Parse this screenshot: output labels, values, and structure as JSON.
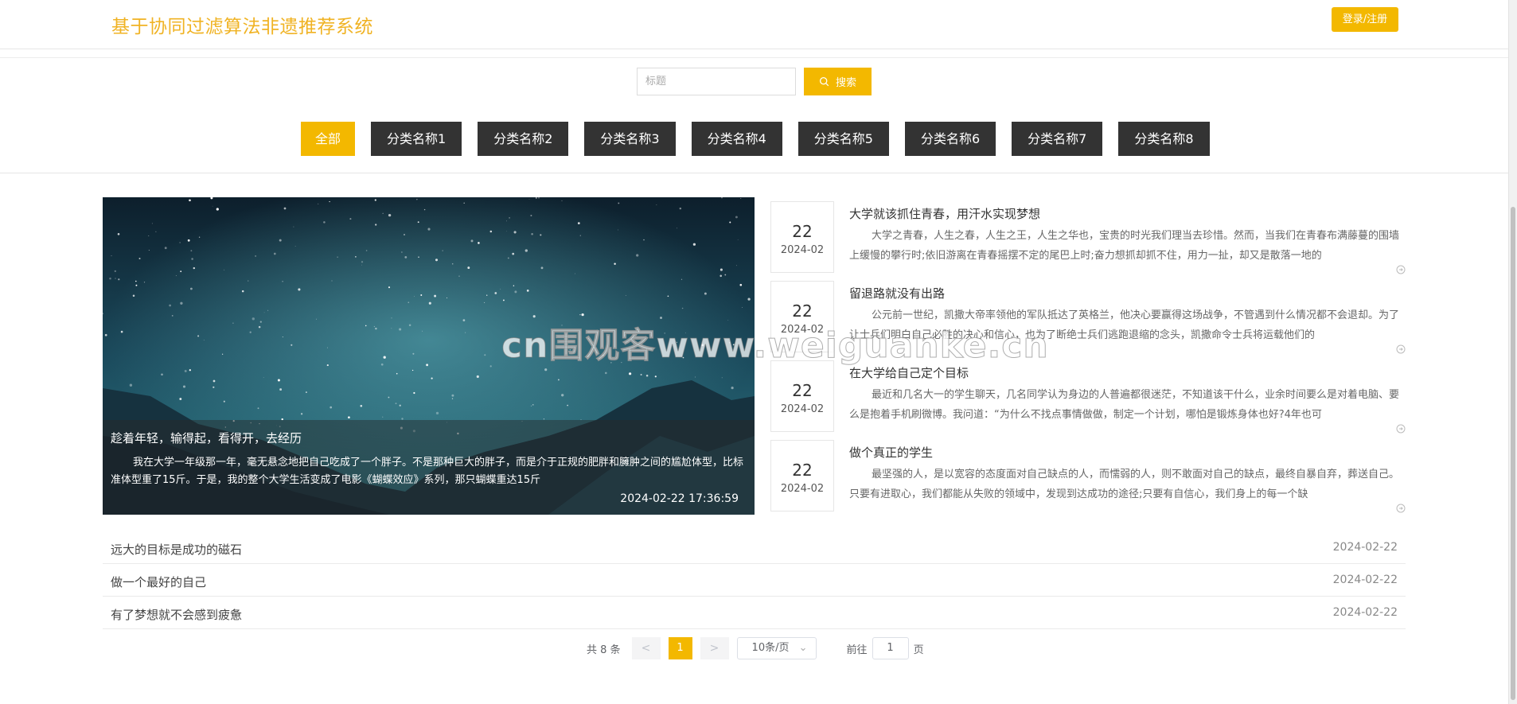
{
  "header": {
    "title": "基于协同过滤算法非遗推荐系统",
    "login_label": "登录/注册"
  },
  "search": {
    "placeholder": "标题",
    "button_label": "搜索"
  },
  "categories": [
    "全部",
    "分类名称1",
    "分类名称2",
    "分类名称3",
    "分类名称4",
    "分类名称5",
    "分类名称6",
    "分类名称7",
    "分类名称8"
  ],
  "featured": {
    "title": "趁着年轻，输得起，看得开，去经历",
    "desc": "我在大学一年级那一年，毫无悬念地把自己吃成了一个胖子。不是那种巨大的胖子，而是介于正规的肥胖和臃肿之间的尴尬体型，比标准体型重了15斤。于是，我的整个大学生活变成了电影《蝴蝶效应》系列，那只蝴蝶重达15斤",
    "datetime": "2024-02-22 17:36:59"
  },
  "news": [
    {
      "day": "22",
      "ym": "2024-02",
      "title": "大学就该抓住青春，用汗水实现梦想",
      "desc": "大学之青春，人生之春，人生之王，人生之华也，宝贵的时光我们理当去珍惜。然而，当我们在青春布满藤蔓的围墙上缓慢的攀行时;依旧游离在青春摇摆不定的尾巴上时;奋力想抓却抓不住，用力一扯，却又是散落一地的"
    },
    {
      "day": "22",
      "ym": "2024-02",
      "title": "留退路就没有出路",
      "desc": "公元前一世纪，凯撒大帝率领他的军队抵达了英格兰，他决心要赢得这场战争，不管遇到什么情况都不会退却。为了让士兵们明白自己必胜的决心和信心，也为了断绝士兵们逃跑退缩的念头，凯撒命令士兵将运载他们的"
    },
    {
      "day": "22",
      "ym": "2024-02",
      "title": "在大学给自己定个目标",
      "desc": "最近和几名大一的学生聊天，几名同学认为身边的人普遍都很迷茫，不知道该干什么，业余时间要么是对着电脑、要么是抱着手机刷微博。我问道：“为什么不找点事情做做，制定一个计划，哪怕是锻炼身体也好?4年也可"
    },
    {
      "day": "22",
      "ym": "2024-02",
      "title": "做个真正的学生",
      "desc": "最坚强的人，是以宽容的态度面对自己缺点的人，而懦弱的人，则不敢面对自己的缺点，最终自暴自弃，葬送自己。只要有进取心，我们都能从失败的领域中，发现到达成功的途径;只要有自信心，我们身上的每一个缺"
    }
  ],
  "list": [
    {
      "title": "远大的目标是成功的磁石",
      "date": "2024-02-22"
    },
    {
      "title": "做一个最好的自己",
      "date": "2024-02-22"
    },
    {
      "title": "有了梦想就不会感到疲惫",
      "date": "2024-02-22"
    }
  ],
  "pagination": {
    "total": "共 8 条",
    "prev": "<",
    "current": "1",
    "next": ">",
    "page_size": "10条/页",
    "goto_label": "前往",
    "goto_value": "1",
    "page_unit": "页"
  },
  "watermark": "cn围观客www.weiguanke.cn",
  "colors": {
    "accent": "#f3b800",
    "title": "#f0b324",
    "dark_button": "#333333"
  }
}
